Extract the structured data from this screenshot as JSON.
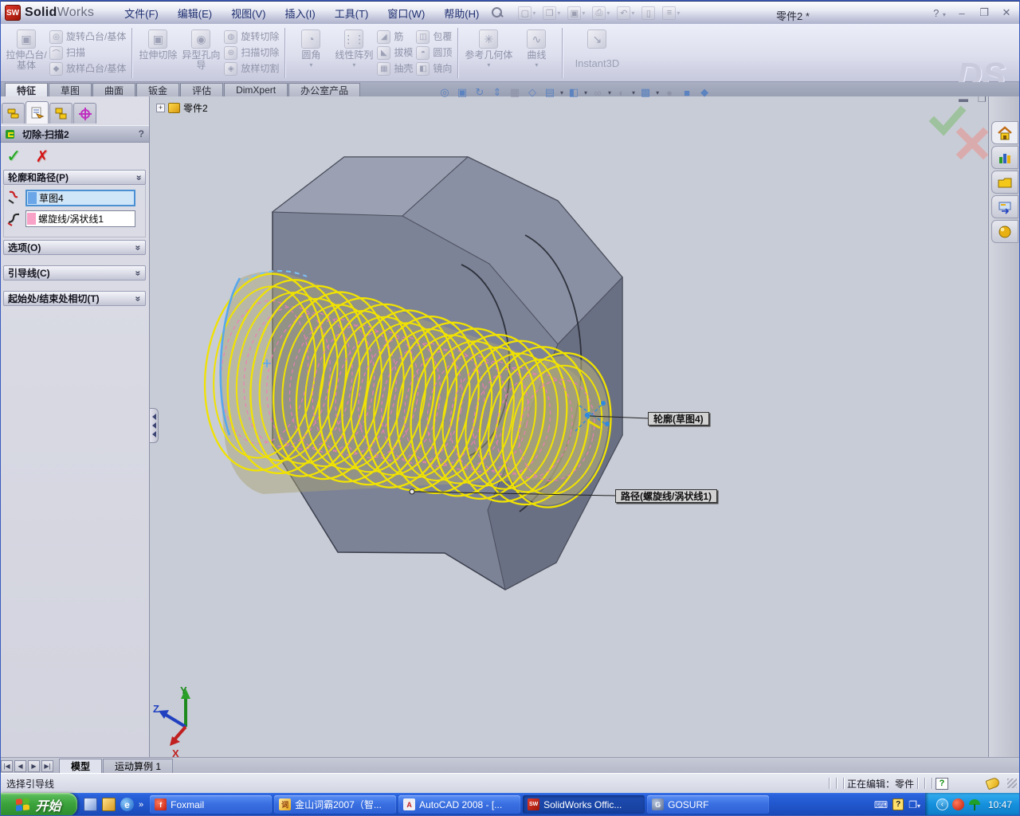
{
  "colors": {
    "viewport_bg": "#c8ccd6",
    "nut_gray": "#7d8397",
    "helix_yellow": "#f0e202",
    "preview_olive": "#aaa272",
    "path_pink": "#f07db4",
    "sketch_blue": "#58a8ec",
    "confirm_green": "#a5d6a0",
    "confirm_red": "#e8a8a8",
    "taskbar_blue": "#2258cf",
    "start_green": "#3da53d",
    "tray_blue": "#1590dc",
    "logo_red": "#c42814"
  },
  "titlebar": {
    "logo": "SW",
    "app_bold": "Solid",
    "app_light": "Works",
    "menus": [
      "文件(F)",
      "编辑(E)",
      "视图(V)",
      "插入(I)",
      "工具(T)",
      "窗口(W)",
      "帮助(H)"
    ],
    "doc_title": "零件2 *",
    "help": "?",
    "minimize": "–",
    "maximize": "❐",
    "close": "✕"
  },
  "ribbon": {
    "extrude_boss": "拉伸凸台/基体",
    "revolve_boss": "旋转凸台/基体",
    "sweep": "扫描",
    "loft_boss": "放样凸台/基体",
    "extrude_cut": "拉伸切除",
    "hole_wizard": "异型孔向导",
    "revolve_cut": "旋转切除",
    "sweep_cut": "扫描切除",
    "loft_cut": "放样切割",
    "fillet": "圆角",
    "linear_pattern": "线性阵列",
    "rib": "筋",
    "draft": "拔模",
    "shell": "抽壳",
    "wrap": "包覆",
    "dome": "圆顶",
    "mirror": "镜向",
    "reference_geometry": "参考几何体",
    "curves": "曲线",
    "instant3d": "Instant3D",
    "watermark": "DS"
  },
  "command_tabs": {
    "features": "特征",
    "sketch": "草图",
    "surfaces": "曲面",
    "sheet_metal": "钣金",
    "evaluate": "评估",
    "dimxpert": "DimXpert",
    "office": "办公室产品"
  },
  "property_manager": {
    "title": "切除-扫描2",
    "help": "?",
    "profile_path_label": "轮廓和路径(P)",
    "profile_value": "草图4",
    "path_value": "螺旋线/涡状线1",
    "options_label": "选项(O)",
    "guide_curves_label": "引导线(C)",
    "tangency_label": "起始处/结束处相切(T)"
  },
  "viewport": {
    "tree_root": "零件2",
    "tree_expander": "+",
    "profile_callout": "轮廓(草图4)",
    "path_callout": "路径(螺旋线/涡状线1)",
    "triad": {
      "x_label": "X",
      "y_label": "Y",
      "z_label": "Z"
    }
  },
  "bottom_bar": {
    "model_tab": "模型",
    "motion_tab": "运动算例 1"
  },
  "status_bar": {
    "message": "选择引导线",
    "editing": "正在编辑：零件",
    "help_badge": "?"
  },
  "taskbar": {
    "start_label": "开始",
    "quick_launch_overflow": "»",
    "tasks": [
      {
        "label": "Foxmail"
      },
      {
        "label": "金山词霸2007（智..."
      },
      {
        "label": "AutoCAD 2008 - [..."
      },
      {
        "label": "SolidWorks Offic..."
      },
      {
        "label": "GOSURF"
      }
    ],
    "clock": "10:47"
  },
  "icons": {
    "titlebar": [
      "search-icon",
      "new-document-icon",
      "open-icon",
      "save-icon",
      "print-icon",
      "undo-icon",
      "select-icon",
      "options-icon"
    ],
    "view_toolbar": [
      "zoom-to-fit-icon",
      "zoom-to-area-icon",
      "rotate-view-icon",
      "pan-icon",
      "hidden-lines-icon",
      "view-orientation-icon",
      "standard-views-icon",
      "display-style-icon",
      "hide-show-items-icon",
      "shadow-icon",
      "edit-appearance-icon",
      "scene-icon",
      "shaded-view-icon",
      "section-view-icon"
    ],
    "property_manager_tabs": [
      "featuremanager-tree-icon",
      "propertymanager-icon",
      "configurationmanager-icon",
      "dimxpertmanager-icon"
    ],
    "task_pane": [
      "resources-home-icon",
      "design-library-icon",
      "file-explorer-icon",
      "search-results-icon",
      "custom-properties-icon"
    ],
    "tray": [
      "keyboard-icon",
      "help-book-icon",
      "display-icon",
      "hide-icons-icon",
      "foxmail-tray-icon",
      "antivirus-umbrella-icon"
    ]
  }
}
